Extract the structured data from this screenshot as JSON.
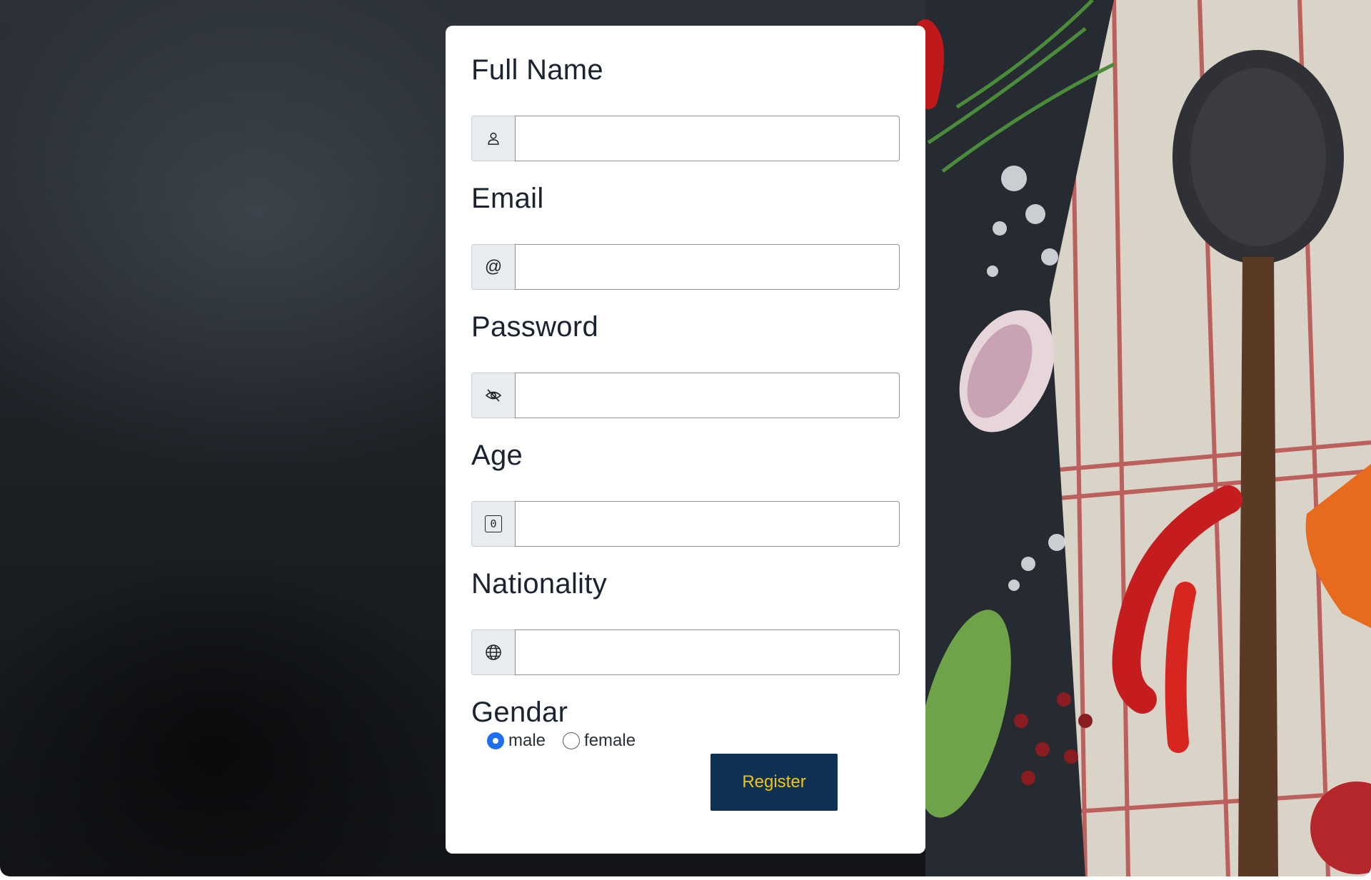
{
  "form": {
    "fields": [
      {
        "label": "Full Name",
        "icon": "user-icon",
        "value": ""
      },
      {
        "label": "Email",
        "icon": "at-icon",
        "value": ""
      },
      {
        "label": "Password",
        "icon": "eye-slash-icon",
        "value": ""
      },
      {
        "label": "Age",
        "icon": "number-0-icon",
        "value": ""
      },
      {
        "label": "Nationality",
        "icon": "globe-icon",
        "value": ""
      }
    ],
    "gender_label": "Gendar",
    "gender_options": [
      {
        "label": "male",
        "checked": true
      },
      {
        "label": "female",
        "checked": false
      }
    ],
    "age_icon_text": "0",
    "email_icon_text": "@",
    "register_label": "Register"
  },
  "colors": {
    "button_bg": "#0f3153",
    "button_text": "#f1c40f",
    "radio_accent": "#1e6ef2"
  }
}
